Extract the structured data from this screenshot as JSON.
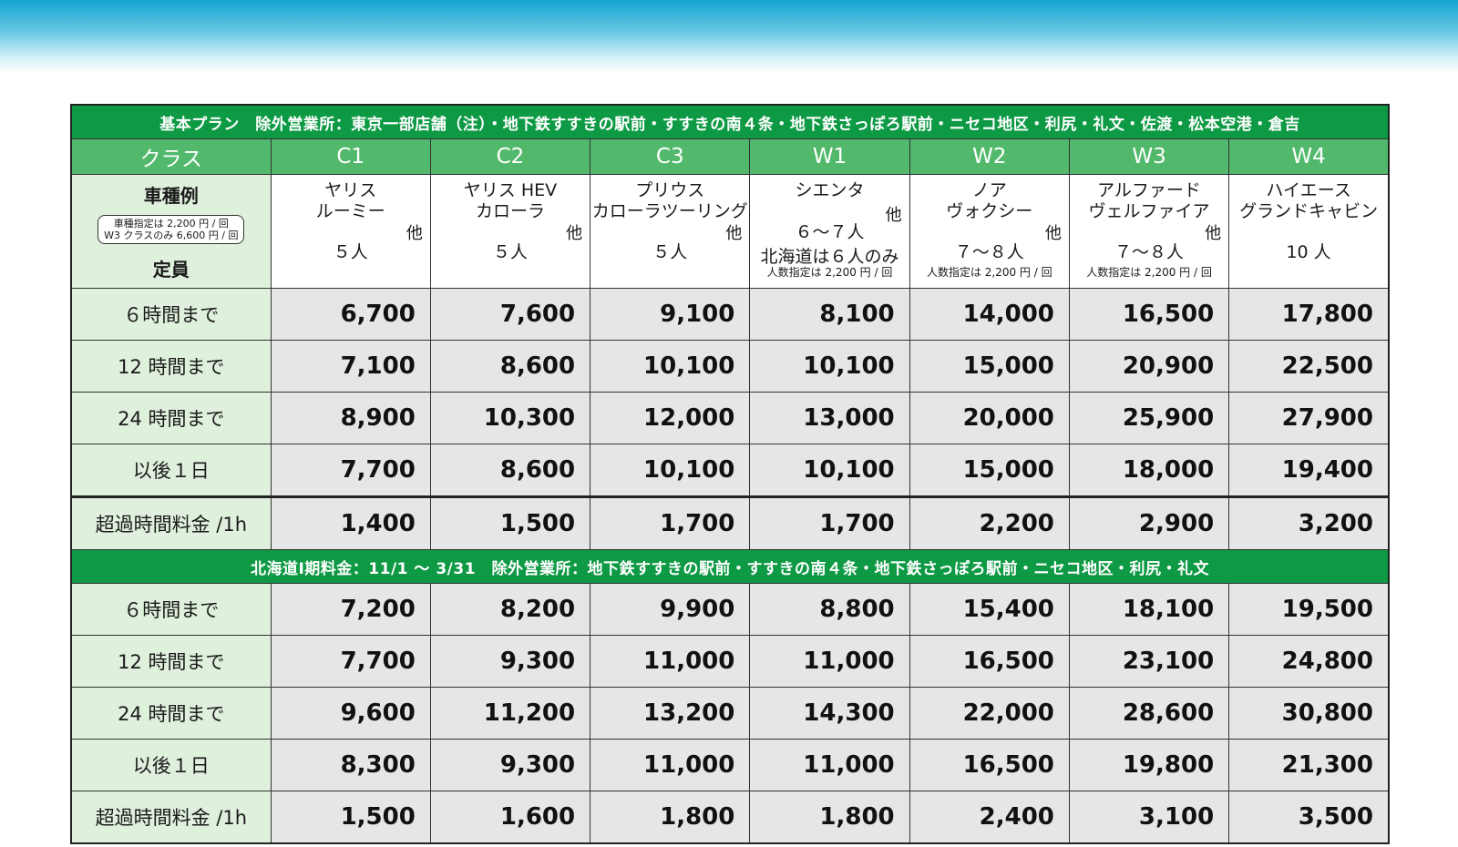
{
  "basic": {
    "banner": "基本プラン　除外営業所：東京一部店舗（注）・地下鉄すすきの駅前・すすきの南４条・地下鉄さっぽろ駅前・ニセコ地区・利尻・礼文・佐渡・松本空港・倉吉",
    "class_label": "クラス",
    "classes": [
      "C1",
      "C2",
      "C3",
      "W1",
      "W2",
      "W3",
      "W4"
    ],
    "vehicle_label": {
      "title": "車種例",
      "note1": "車種指定は 2,200 円 / 回",
      "note2": "W3 クラスのみ 6,600 円 / 回",
      "capacity": "定員"
    },
    "vehicles": [
      {
        "line1": "ヤリス",
        "line2": "ルーミー",
        "other": "他",
        "cap": "５人"
      },
      {
        "line1": "ヤリス HEV",
        "line2": "カローラ",
        "other": "他",
        "cap": "５人"
      },
      {
        "line1": "プリウス",
        "line2": "カローラツーリング",
        "other": "他",
        "cap": "５人"
      },
      {
        "line1": "シエンタ",
        "other": "他",
        "cap": "６～７人",
        "hokkaido": "北海道は６人のみ",
        "note": "人数指定は 2,200 円 / 回"
      },
      {
        "line1": "ノア",
        "line2": "ヴォクシー",
        "other": "他",
        "cap": "７～８人",
        "note": "人数指定は 2,200 円 / 回"
      },
      {
        "line1": "アルファード",
        "line2": "ヴェルファイア",
        "other": "他",
        "cap": "７～８人",
        "note": "人数指定は 2,200 円 / 回"
      },
      {
        "line1": "ハイエース",
        "line2": "グランドキャビン",
        "cap": "10 人"
      }
    ],
    "rows": [
      {
        "label": "６時間まで",
        "prices": [
          "6,700",
          "7,600",
          "9,100",
          "8,100",
          "14,000",
          "16,500",
          "17,800"
        ]
      },
      {
        "label": "12 時間まで",
        "prices": [
          "7,100",
          "8,600",
          "10,100",
          "10,100",
          "15,000",
          "20,900",
          "22,500"
        ]
      },
      {
        "label": "24 時間まで",
        "prices": [
          "8,900",
          "10,300",
          "12,000",
          "13,000",
          "20,000",
          "25,900",
          "27,900"
        ]
      },
      {
        "label": "以後１日",
        "prices": [
          "7,700",
          "8,600",
          "10,100",
          "10,100",
          "15,000",
          "18,000",
          "19,400"
        ]
      },
      {
        "label": "超過時間料金 /1h",
        "prices": [
          "1,400",
          "1,500",
          "1,700",
          "1,700",
          "2,200",
          "2,900",
          "3,200"
        ]
      }
    ]
  },
  "hokkaido": {
    "banner": "北海道Ⅰ期料金：11/1 ～ 3/31　除外営業所：地下鉄すすきの駅前・すすきの南４条・地下鉄さっぽろ駅前・ニセコ地区・利尻・礼文",
    "rows": [
      {
        "label": "６時間まで",
        "prices": [
          "7,200",
          "8,200",
          "9,900",
          "8,800",
          "15,400",
          "18,100",
          "19,500"
        ]
      },
      {
        "label": "12 時間まで",
        "prices": [
          "7,700",
          "9,300",
          "11,000",
          "11,000",
          "16,500",
          "23,100",
          "24,800"
        ]
      },
      {
        "label": "24 時間まで",
        "prices": [
          "9,600",
          "11,200",
          "13,200",
          "14,300",
          "22,000",
          "28,600",
          "30,800"
        ]
      },
      {
        "label": "以後１日",
        "prices": [
          "8,300",
          "9,300",
          "11,000",
          "11,000",
          "16,500",
          "19,800",
          "21,300"
        ]
      },
      {
        "label": "超過時間料金 /1h",
        "prices": [
          "1,500",
          "1,600",
          "1,800",
          "1,800",
          "2,400",
          "3,100",
          "3,500"
        ]
      }
    ]
  },
  "colors": {
    "banner_green": "#0e9a45",
    "header_green": "#52b96c",
    "label_bg": "#dff0dc",
    "price_bg": "#e6e6e8",
    "top_band": "#13a4d0"
  }
}
